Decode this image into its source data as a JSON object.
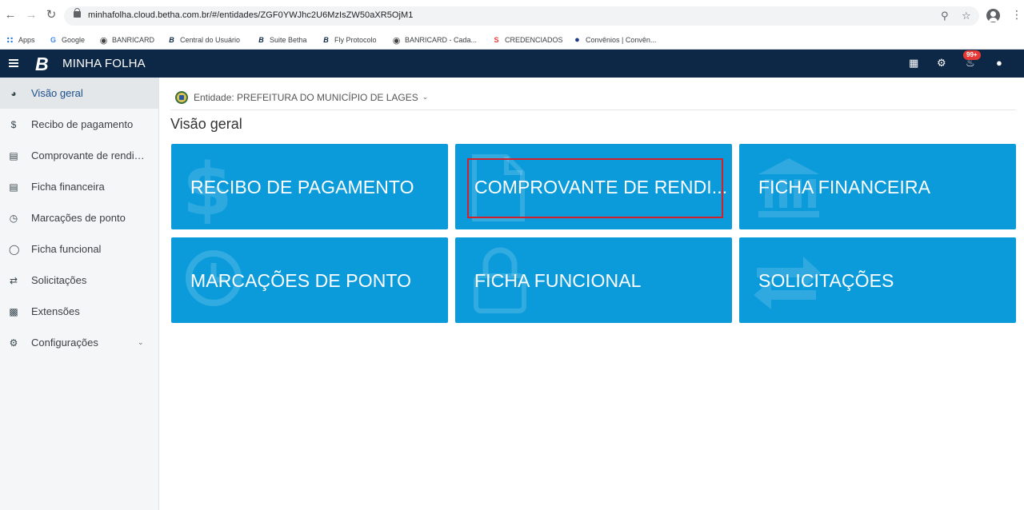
{
  "browser": {
    "url": "minhafolha.cloud.betha.com.br/#/entidades/ZGF0YWJhc2U6MzIsZW50aXR5OjM1"
  },
  "bookmarks": [
    {
      "label": "Apps",
      "icon": "apps-grid-icon"
    },
    {
      "label": "Google",
      "icon": "google-icon"
    },
    {
      "label": "BANRICARD",
      "icon": "globe-icon"
    },
    {
      "label": "Central do Usuário",
      "icon": "betha-icon"
    },
    {
      "label": "Suite Betha",
      "icon": "betha-icon"
    },
    {
      "label": "Fly Protocolo",
      "icon": "betha-icon"
    },
    {
      "label": "BANRICARD - Cada...",
      "icon": "globe-icon"
    },
    {
      "label": "CREDENCIADOS",
      "icon": "credenciados-icon"
    },
    {
      "label": "Convênios | Convên...",
      "icon": "convenios-icon"
    }
  ],
  "header": {
    "title": "MINHA FOLHA",
    "notification_badge": "99+",
    "colors": {
      "header_bg": "#0d2847",
      "tile_bg": "#0b9bdb"
    }
  },
  "sidebar": {
    "items": [
      {
        "label": "Visão geral",
        "icon": "pie-chart-icon",
        "active": true
      },
      {
        "label": "Recibo de pagamento",
        "icon": "dollar-icon"
      },
      {
        "label": "Comprovante de rendimentos",
        "icon": "document-icon"
      },
      {
        "label": "Ficha financeira",
        "icon": "bank-icon"
      },
      {
        "label": "Marcações de ponto",
        "icon": "clock-icon"
      },
      {
        "label": "Ficha funcional",
        "icon": "user-icon"
      },
      {
        "label": "Solicitações",
        "icon": "transfer-arrows-icon"
      },
      {
        "label": "Extensões",
        "icon": "puzzle-icon"
      },
      {
        "label": "Configurações",
        "icon": "cogs-icon",
        "expandable": true
      }
    ]
  },
  "main": {
    "entity": "Entidade: PREFEITURA DO MUNICÍPIO DE LAGES",
    "page_title": "Visão geral",
    "tiles": [
      {
        "label": "RECIBO DE PAGAMENTO",
        "icon": "dollar-icon"
      },
      {
        "label": "COMPROVANTE DE RENDI...",
        "icon": "document-icon",
        "highlighted": true
      },
      {
        "label": "FICHA FINANCEIRA",
        "icon": "bank-icon"
      },
      {
        "label": "MARCAÇÕES DE PONTO",
        "icon": "clock-icon"
      },
      {
        "label": "FICHA FUNCIONAL",
        "icon": "lock-icon"
      },
      {
        "label": "SOLICITAÇÕES",
        "icon": "transfer-arrows-icon"
      }
    ]
  }
}
